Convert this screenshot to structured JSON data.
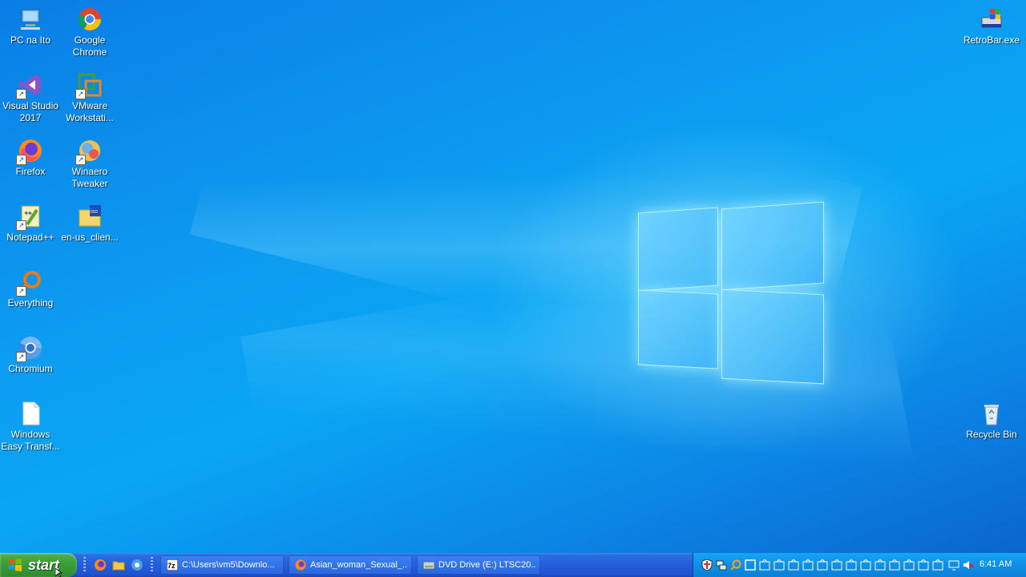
{
  "desktop": {
    "icons": [
      {
        "label": "PC na Ito",
        "icon": "computer-icon"
      },
      {
        "label": "Google\nChrome",
        "icon": "chrome-icon"
      },
      {
        "label": "Visual Studio\n2017",
        "icon": "visual-studio-icon"
      },
      {
        "label": "VMware\nWorkstati...",
        "icon": "vmware-icon"
      },
      {
        "label": "Firefox",
        "icon": "firefox-icon"
      },
      {
        "label": "Winaero\nTweaker",
        "icon": "winaero-icon"
      },
      {
        "label": "Notepad++",
        "icon": "notepadpp-icon"
      },
      {
        "label": "en-us_clien...",
        "icon": "iso-file-icon"
      },
      {
        "label": "Everything",
        "icon": "everything-icon"
      },
      {
        "label": "Chromium",
        "icon": "chromium-icon"
      },
      {
        "label": "Windows\nEasy Transf...",
        "icon": "blank-file-icon"
      },
      {
        "label": "RetroBar.exe",
        "icon": "retrobar-icon"
      },
      {
        "label": "Recycle Bin",
        "icon": "recycle-bin-icon"
      }
    ],
    "wallpaper": "windows-10-hero",
    "colors": {
      "accent": "#0a9cf0",
      "taskbar": "#245ddb",
      "start": "#3c9e3a",
      "tray": "#0f90e6"
    }
  },
  "taskbar": {
    "start_label": "start",
    "quick_launch": [
      "firefox-icon",
      "folder-icon",
      "edge-icon"
    ],
    "tasks": [
      {
        "label": "C:\\Users\\vm5\\Downlo...",
        "icon": "7zip-icon"
      },
      {
        "label": "Asian_woman_Sexual_...",
        "icon": "firefox-icon"
      },
      {
        "label": "DVD Drive (E:) LTSC20...",
        "icon": "dvd-icon"
      }
    ],
    "clock": "6:41 AM"
  }
}
